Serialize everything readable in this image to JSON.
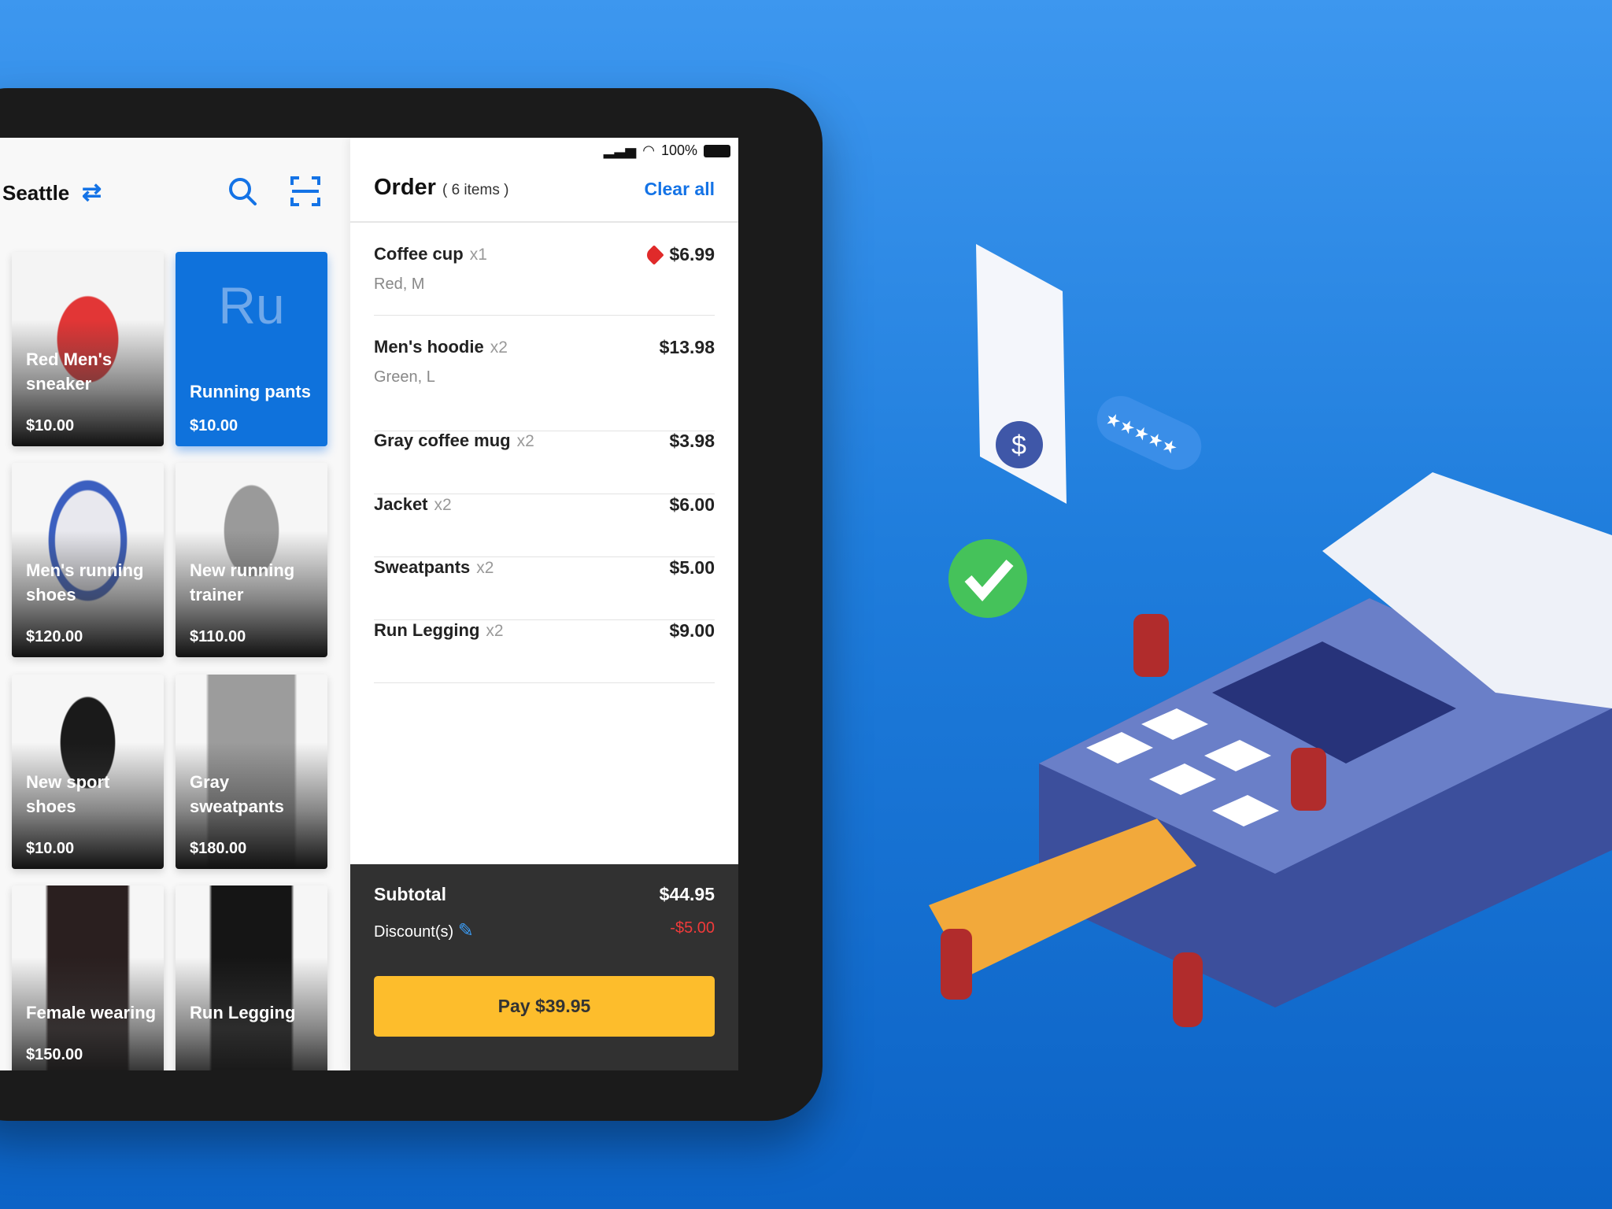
{
  "status_bar": {
    "battery": "100%"
  },
  "catalog": {
    "location": "Seattle",
    "icons": [
      "swap-icon",
      "search-icon",
      "scan-icon"
    ],
    "products": [
      {
        "name": "Red Men's sneaker",
        "price": "$10.00"
      },
      {
        "name": "Running pants",
        "price": "$10.00",
        "initials": "Ru"
      },
      {
        "name": "Men's running shoes",
        "price": "$120.00"
      },
      {
        "name": "New running trainer",
        "price": "$110.00"
      },
      {
        "name": "New sport shoes",
        "price": "$10.00"
      },
      {
        "name": "Gray sweatpants",
        "price": "$180.00"
      },
      {
        "name": "Female wearing",
        "price": "$150.00"
      },
      {
        "name": "Run Legging",
        "price": ""
      }
    ]
  },
  "order": {
    "title": "Order",
    "count": "( 6 items )",
    "clear_all": "Clear all",
    "items": [
      {
        "name": "Coffee cup",
        "qty": "x1",
        "variant": "Red, M",
        "price": "$6.99",
        "discount_tag": true
      },
      {
        "name": "Men's hoodie",
        "qty": "x2",
        "variant": "Green, L",
        "price": "$13.98"
      },
      {
        "name": "Gray coffee mug",
        "qty": "x2",
        "price": "$3.98"
      },
      {
        "name": "Jacket",
        "qty": "x2",
        "price": "$6.00"
      },
      {
        "name": "Sweatpants",
        "qty": "x2",
        "price": "$5.00"
      },
      {
        "name": "Run Legging",
        "qty": "x2",
        "price": "$9.00"
      }
    ],
    "subtotal_label": "Subtotal",
    "subtotal": "$44.95",
    "discount_label": "Discount(s)",
    "discount": "-$5.00",
    "pay_label": "Pay $39.95"
  },
  "colors": {
    "accent": "#1473e6",
    "pay": "#fdbd2c",
    "discount": "#f03a3a",
    "background": "#1f7ddc"
  }
}
